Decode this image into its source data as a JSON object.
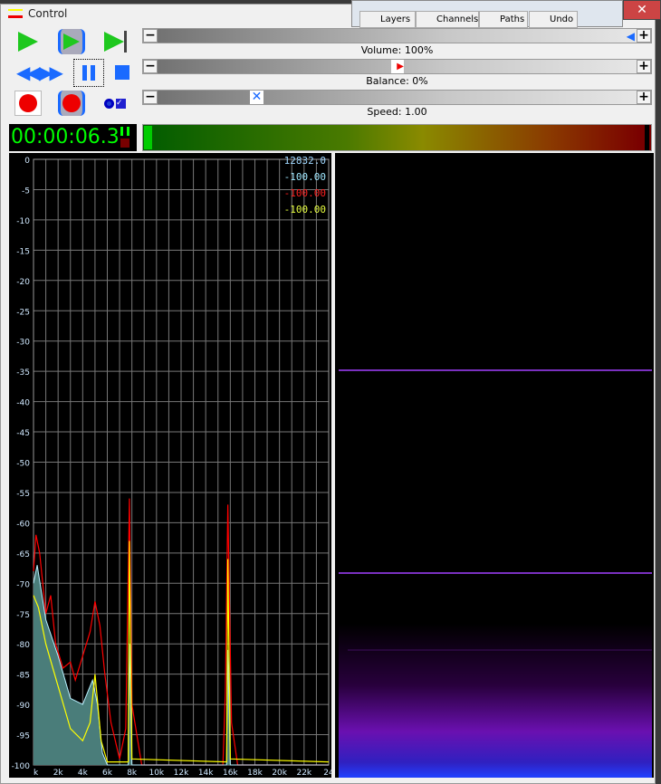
{
  "background_window": {
    "tabs": [
      "Layers",
      "Channels",
      "Paths",
      "Undo"
    ],
    "close_label": "✕"
  },
  "window": {
    "title": "Control"
  },
  "sliders": {
    "volume_label": "Volume: 100%",
    "volume": 1.0,
    "balance_label": "Balance: 0%",
    "balance": 0.0,
    "speed_label": "Speed: 1.00",
    "speed": 1.0
  },
  "timer": "00:00:06.3",
  "colors": {
    "red": "#ff0000",
    "yellow": "#ffff00",
    "cyan_fill": "#4a7d7a",
    "cyan_line": "#b8f0ff",
    "accent": "#1a6aff",
    "green": "#1ec81e"
  },
  "legend": {
    "freq": "12832.0",
    "cyan": "-100.00",
    "red": "-100.00",
    "yellow": "-100.00",
    "freq_color": "#a0d8ff",
    "cyan_color": "#a0e8ff",
    "red_color": "#ff2020",
    "yellow_color": "#e8ff40"
  },
  "chart_data": {
    "type": "line",
    "xlim": [
      0,
      24
    ],
    "ylim": [
      -100,
      0
    ],
    "y_ticks": [
      "0",
      "-5",
      "-10",
      "-15",
      "-20",
      "-25",
      "-30",
      "-35",
      "-40",
      "-45",
      "-50",
      "-55",
      "-60",
      "-65",
      "-70",
      "-75",
      "-80",
      "-85",
      "-90",
      "-95",
      "-100"
    ],
    "x_ticks": [
      "k",
      "2k",
      "4k",
      "6k",
      "8k",
      "10k",
      "12k",
      "14k",
      "16k",
      "18k",
      "20k",
      "22k",
      "24"
    ],
    "grid": true,
    "series": [
      {
        "color": "#ff0000",
        "points": [
          [
            0,
            -68
          ],
          [
            0.2,
            -62
          ],
          [
            0.5,
            -65
          ],
          [
            1,
            -75
          ],
          [
            1.4,
            -72
          ],
          [
            1.8,
            -80
          ],
          [
            2.4,
            -84
          ],
          [
            3,
            -83
          ],
          [
            3.4,
            -86
          ],
          [
            4,
            -82
          ],
          [
            4.6,
            -78
          ],
          [
            5,
            -73
          ],
          [
            5.4,
            -77
          ],
          [
            5.8,
            -85
          ],
          [
            6.3,
            -93
          ],
          [
            7,
            -99
          ],
          [
            7.5,
            -94
          ],
          [
            7.8,
            -56
          ],
          [
            8,
            -90
          ],
          [
            8.4,
            -95
          ],
          [
            8.8,
            -100
          ],
          [
            15.4,
            -100
          ],
          [
            15.6,
            -88
          ],
          [
            15.8,
            -57
          ],
          [
            16.1,
            -93
          ],
          [
            16.6,
            -100
          ],
          [
            24,
            -100
          ]
        ]
      },
      {
        "color": "#00e0e0",
        "fill": true,
        "points": [
          [
            0,
            -70
          ],
          [
            0.3,
            -67
          ],
          [
            1,
            -76
          ],
          [
            2,
            -82
          ],
          [
            3,
            -89
          ],
          [
            4,
            -90
          ],
          [
            4.8,
            -86
          ],
          [
            5.2,
            -90
          ],
          [
            5.6,
            -98
          ],
          [
            6,
            -100
          ],
          [
            7.7,
            -100
          ],
          [
            7.8,
            -80
          ],
          [
            8,
            -100
          ],
          [
            15.7,
            -100
          ],
          [
            15.8,
            -81
          ],
          [
            16,
            -100
          ],
          [
            24,
            -100
          ]
        ]
      },
      {
        "color": "#ffff00",
        "points": [
          [
            0,
            -72
          ],
          [
            0.4,
            -74
          ],
          [
            1,
            -80
          ],
          [
            2,
            -87
          ],
          [
            3,
            -94
          ],
          [
            4,
            -96
          ],
          [
            4.6,
            -93
          ],
          [
            5,
            -85
          ],
          [
            5.5,
            -96
          ],
          [
            6,
            -99.5
          ],
          [
            7.7,
            -99.5
          ],
          [
            7.8,
            -63
          ],
          [
            8,
            -99
          ],
          [
            15.7,
            -99.5
          ],
          [
            15.8,
            -66
          ],
          [
            16,
            -99
          ],
          [
            24,
            -99.5
          ]
        ]
      }
    ]
  }
}
